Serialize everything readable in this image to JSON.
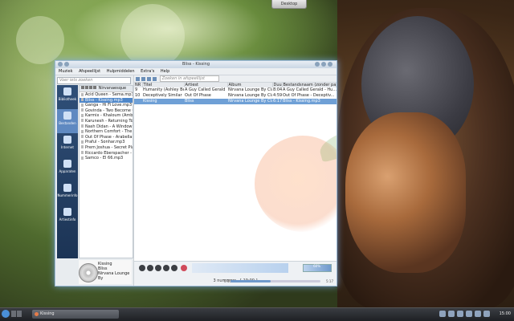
{
  "desktop": {
    "button_label": "Desktop"
  },
  "window": {
    "title": "Bliss - Kissing",
    "menu": [
      "Muziek",
      "Afspeellijst",
      "Hulpmiddelen",
      "Extra's",
      "Help"
    ]
  },
  "sidebar": {
    "search_placeholder": "Voer iets zoeken",
    "tabs": [
      {
        "label": "Bibliotheek",
        "icon": "library-icon"
      },
      {
        "label": "Bestanden",
        "icon": "folder-icon"
      },
      {
        "label": "Internet",
        "icon": "globe-icon"
      },
      {
        "label": "Apparaten",
        "icon": "device-icon"
      },
      {
        "label": "Nummerinfo",
        "icon": "info-icon"
      },
      {
        "label": "Artiestinfo",
        "icon": "person-icon"
      }
    ],
    "browser_path": "Nirvanaesque",
    "files": [
      "Acid Queen - Sema.mp3",
      "Bliss - Kissing.mp3",
      "Ganga - Hi Fi Love.mp3",
      "Govinda - Two Become On",
      "Karmix - Khaloum (Ambier",
      "Karunesh - Returning To Yo",
      "Nash Didan - A Window O",
      "Northern Comfort - The S",
      "Out Of Phase - Arabellam",
      "Praful - Sonhar.mp3",
      "Prem Joshua - Secret Plac",
      "Riccardo Eberspacher - Vi",
      "Samco - El 66.mp3"
    ],
    "selected_index": 1
  },
  "nowplaying": {
    "title": "Kissing",
    "artist": "Bliss",
    "album": "Nirvana Lounge By"
  },
  "playlist": {
    "search_placeholder": "Zoeken in afspeellijst",
    "columns": [
      "NR",
      "Titel",
      "Artiest",
      "Album",
      "Duur",
      "Bestandsnaam (zonder pad)"
    ],
    "rows": [
      {
        "nr": "9",
        "title": "Humanity (Ashley Bee...",
        "artist": "A Guy Called Gerald",
        "album": "Nirvana Lounge By Cla...",
        "duration": "8:04",
        "file": "A Guy Called Gerald - Hu..."
      },
      {
        "nr": "10",
        "title": "Deceptively Similar",
        "artist": "Out Of Phase",
        "album": "Nirvana Lounge By Cla...",
        "duration": "4:59",
        "file": "Out Of Phase - Deceptiv..."
      },
      {
        "nr": "",
        "title": "Kissing",
        "artist": "Bliss",
        "album": "Nirvana Lounge By Cla...",
        "duration": "6:17",
        "file": "Bliss - Kissing.mp3"
      }
    ],
    "active_index": 2
  },
  "controls": {
    "status": "3 nummers - [ 19:00 ]",
    "elapsed": "0:43",
    "remaining": "5:17",
    "volume_label": "60%",
    "progress": 0.45
  },
  "taskbar": {
    "task_label": "Kissing",
    "clock": "15:00"
  }
}
